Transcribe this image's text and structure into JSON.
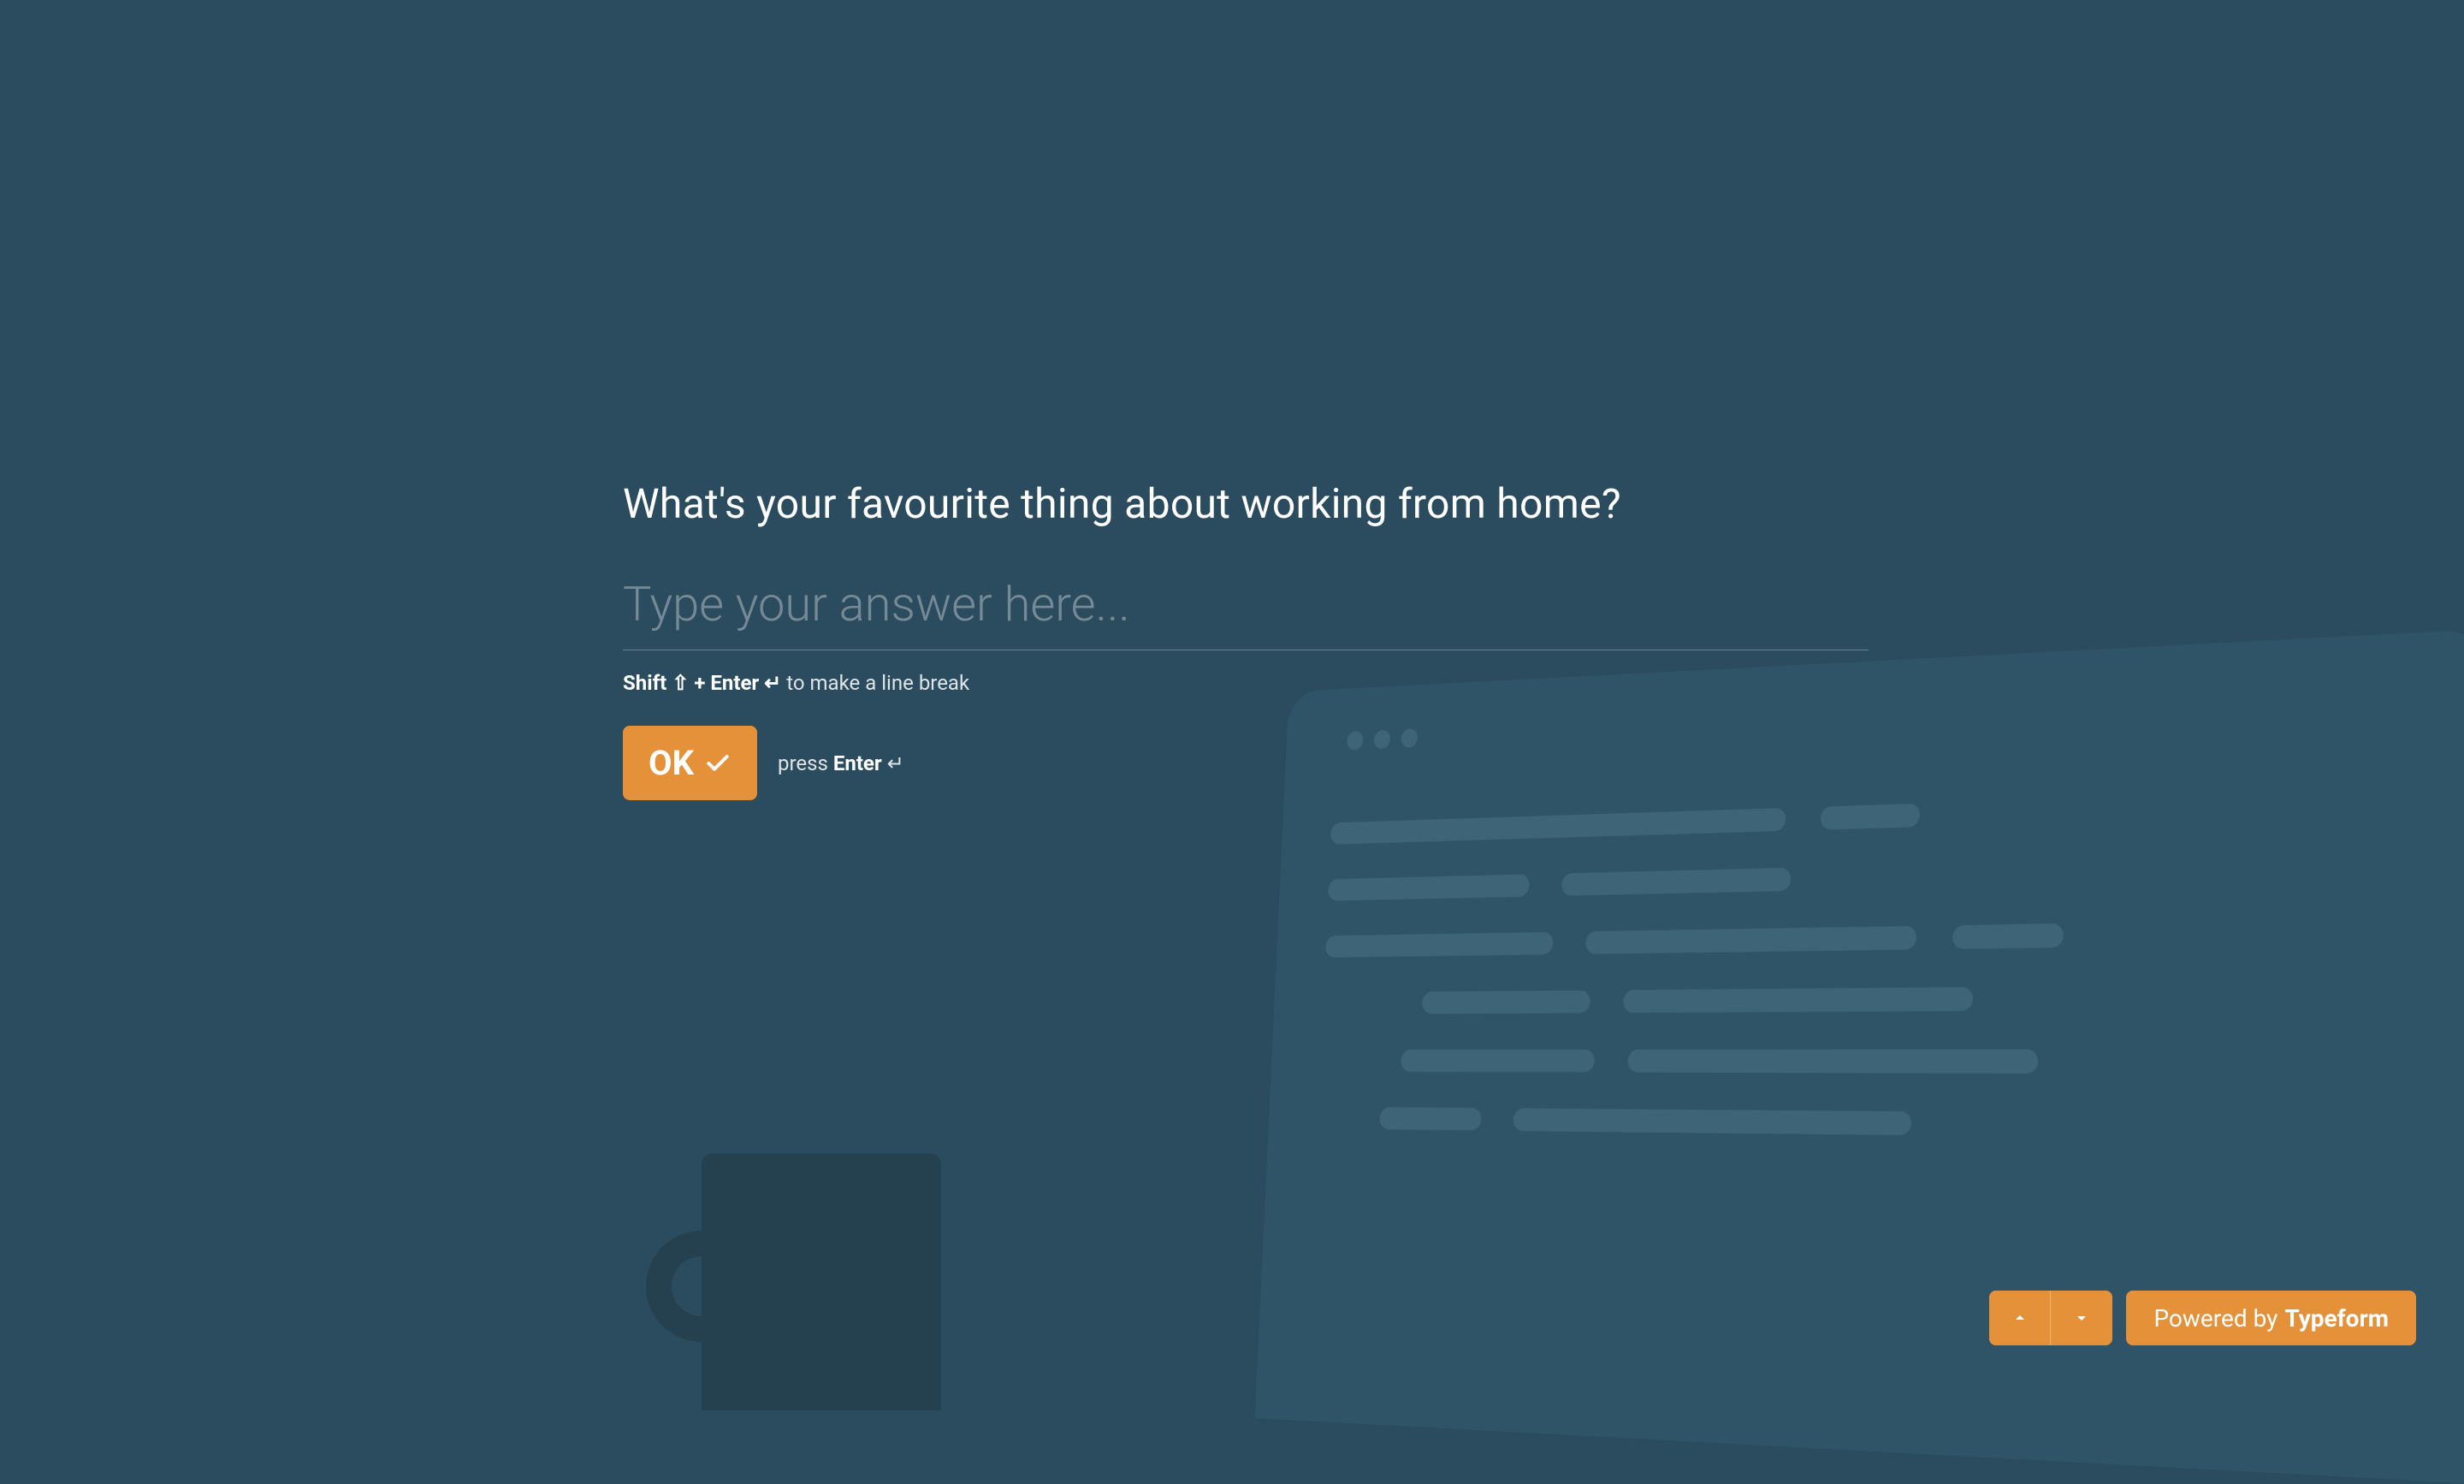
{
  "question": {
    "title": "What's your favourite thing about working from home?",
    "placeholder": "Type your answer here..."
  },
  "hints": {
    "shift_label": "Shift",
    "shift_symbol": "⇧",
    "plus": " + ",
    "enter_label": "Enter",
    "enter_symbol": "↵",
    "line_break_text": " to make a line break",
    "press_text": "press ",
    "press_enter_label": "Enter",
    "press_enter_symbol": " ↵"
  },
  "buttons": {
    "ok_label": "OK"
  },
  "footer": {
    "powered_by_text": "Powered by",
    "brand": "Typeform"
  }
}
